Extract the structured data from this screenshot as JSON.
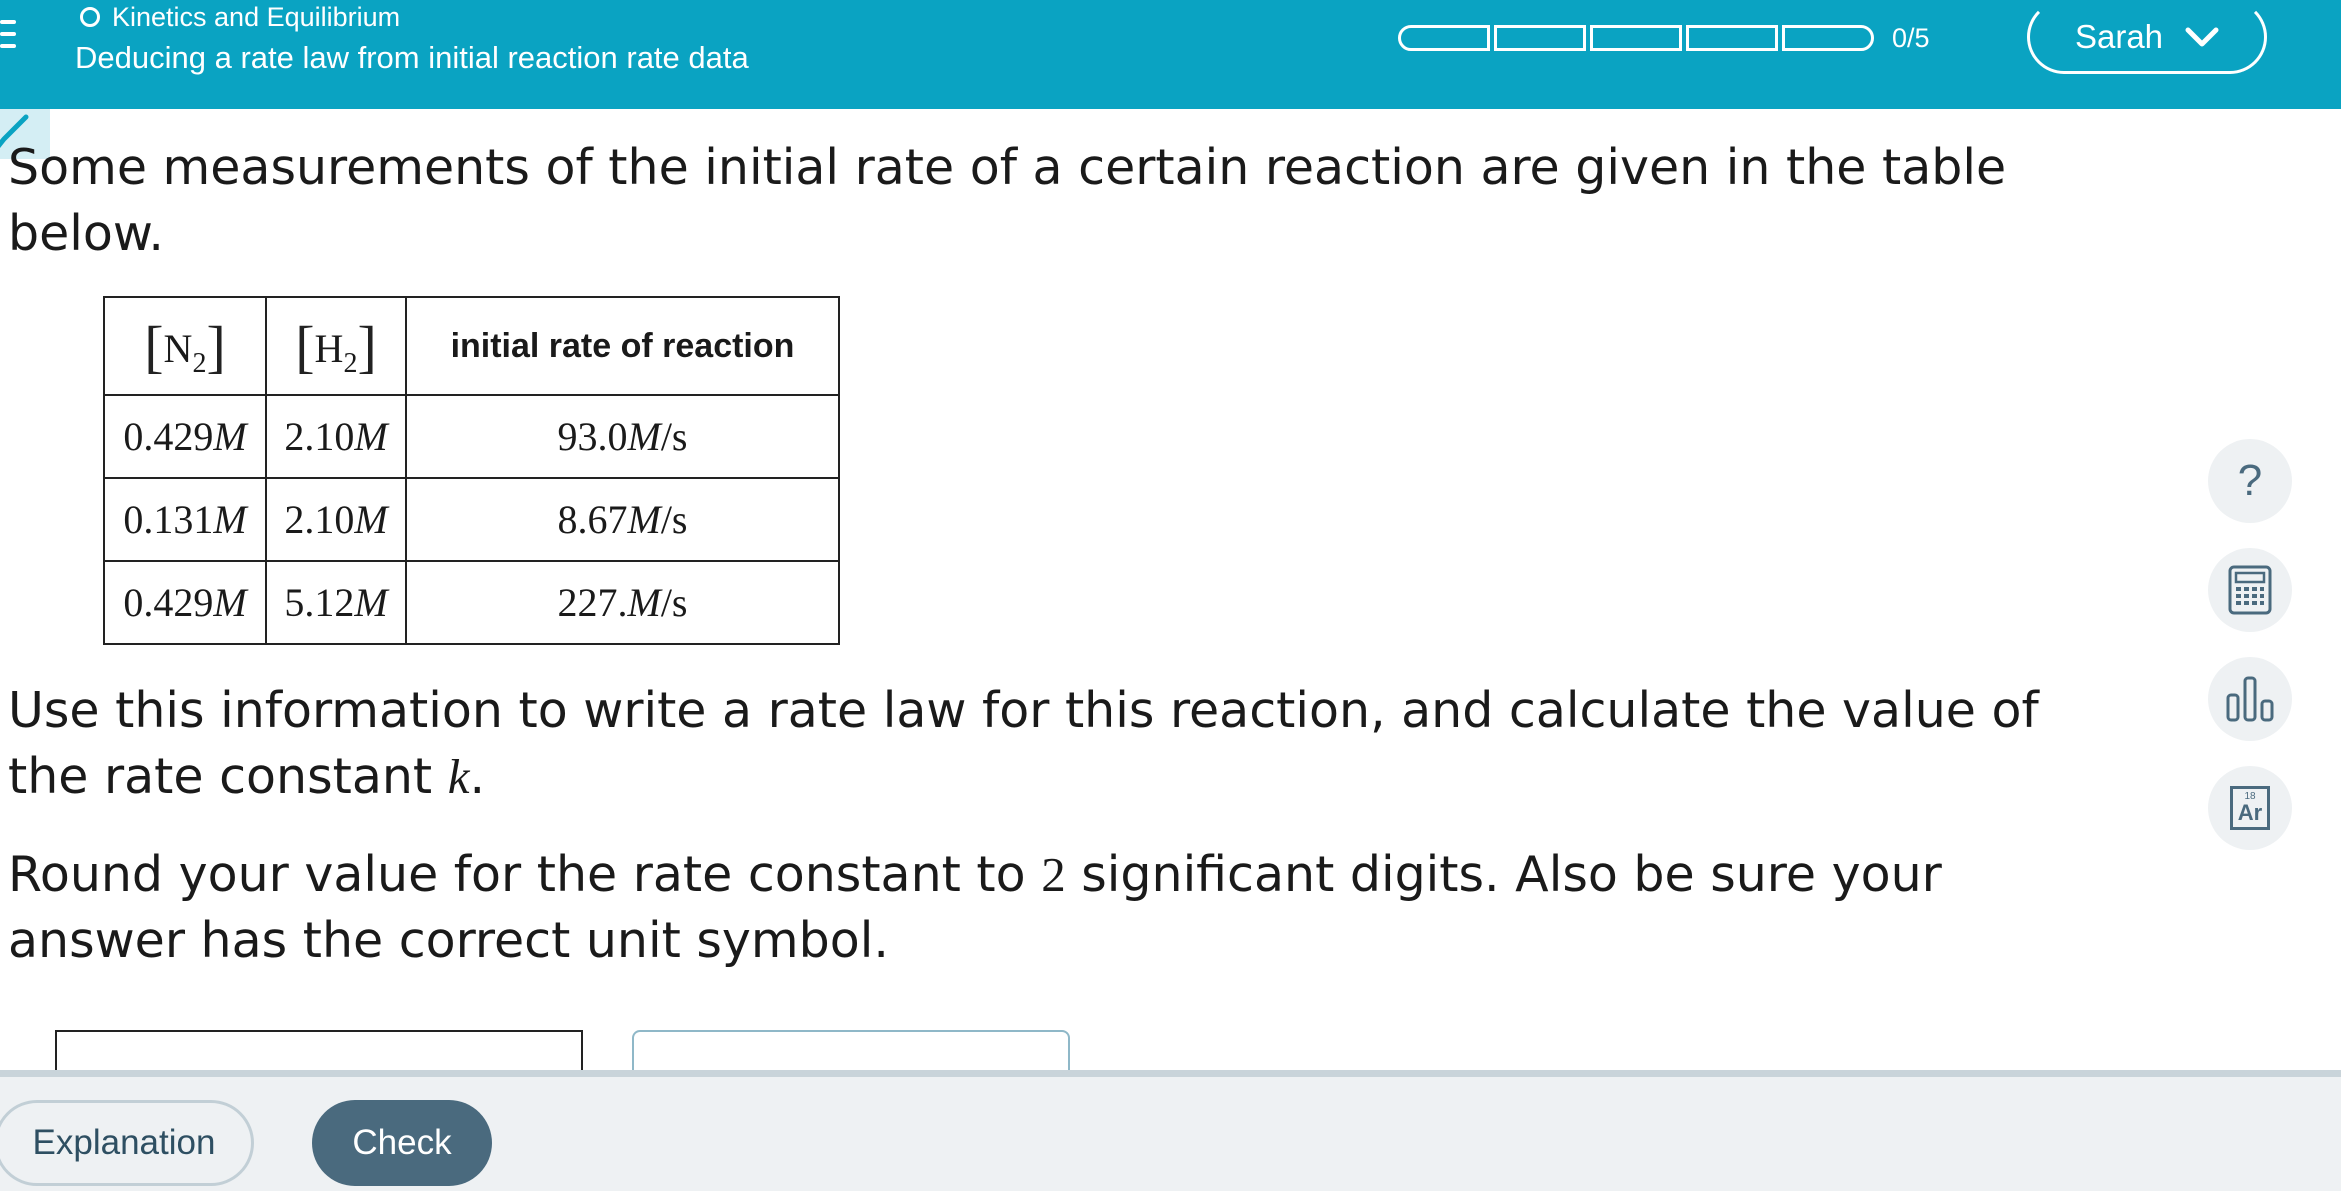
{
  "header": {
    "topic": "Kinetics and Equilibrium",
    "title": "Deducing a rate law from initial reaction rate data",
    "progress": {
      "label": "0/5",
      "completed": 0,
      "total": 5
    },
    "user_name": "Sarah"
  },
  "question": {
    "intro": "Some measurements of the initial rate of a certain reaction are given in the table below.",
    "instruction_before_k": "Use this information to write a rate law for this reaction, and calculate the value of the rate constant ",
    "k_symbol": "k",
    "instruction_end": ".",
    "round_before": "Round your value for the rate constant to ",
    "round_digits": "2",
    "round_after": " significant digits. Also be sure your answer has the correct unit symbol."
  },
  "table": {
    "headers": {
      "col1": {
        "symbol": "N",
        "subscript": "2"
      },
      "col2": {
        "symbol": "H",
        "subscript": "2"
      },
      "col3": "initial rate of reaction"
    },
    "rows": [
      {
        "n2": "0.429",
        "h2": "2.10",
        "rate": "93.0"
      },
      {
        "n2": "0.131",
        "h2": "2.10",
        "rate": "8.67"
      },
      {
        "n2": "0.429",
        "h2": "5.12",
        "rate": "227."
      }
    ],
    "conc_unit": "M",
    "rate_unit_num": "M",
    "rate_unit_den": "/s"
  },
  "tools": {
    "help_glyph": "?"
  },
  "periodic_icon": {
    "number": "18",
    "symbol": "Ar"
  },
  "buttons": {
    "explanation": "Explanation",
    "check": "Check"
  }
}
